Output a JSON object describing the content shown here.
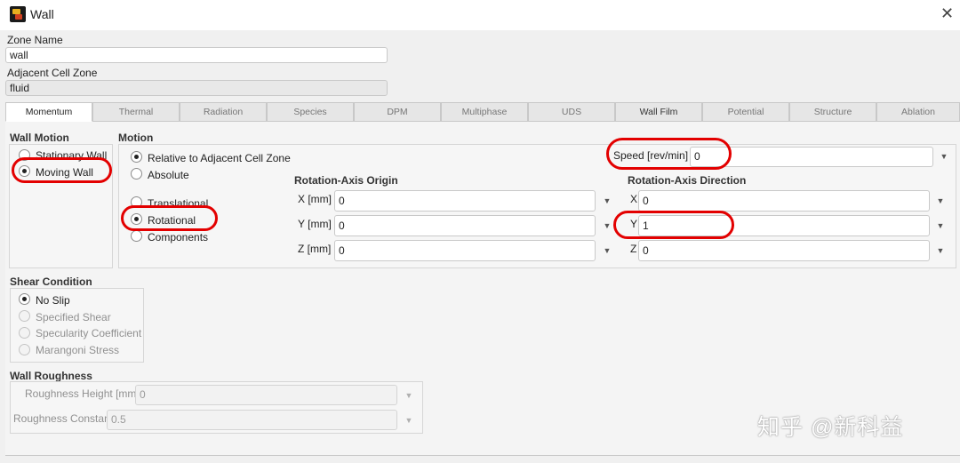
{
  "window": {
    "title": "Wall"
  },
  "zone": {
    "name_label": "Zone Name",
    "name_value": "wall",
    "adjacent_label": "Adjacent Cell Zone",
    "adjacent_value": "fluid"
  },
  "tabs": [
    {
      "label": "Momentum"
    },
    {
      "label": "Thermal"
    },
    {
      "label": "Radiation"
    },
    {
      "label": "Species"
    },
    {
      "label": "DPM"
    },
    {
      "label": "Multiphase"
    },
    {
      "label": "UDS"
    },
    {
      "label": "Wall Film"
    },
    {
      "label": "Potential"
    },
    {
      "label": "Structure"
    },
    {
      "label": "Ablation"
    }
  ],
  "wall_motion": {
    "title": "Wall Motion",
    "stationary": "Stationary Wall",
    "moving": "Moving Wall"
  },
  "motion": {
    "title": "Motion",
    "relative": "Relative to Adjacent Cell Zone",
    "absolute": "Absolute",
    "translational": "Translational",
    "rotational": "Rotational",
    "components": "Components",
    "speed_label": "Speed [rev/min]",
    "speed_value": "0"
  },
  "origin": {
    "title": "Rotation-Axis Origin",
    "x_label": "X [mm]",
    "x_value": "0",
    "y_label": "Y [mm]",
    "y_value": "0",
    "z_label": "Z [mm]",
    "z_value": "0"
  },
  "direction": {
    "title": "Rotation-Axis Direction",
    "x_label": "X",
    "x_value": "0",
    "y_label": "Y",
    "y_value": "1",
    "z_label": "Z",
    "z_value": "0"
  },
  "shear": {
    "title": "Shear Condition",
    "no_slip": "No Slip",
    "specified_shear": "Specified Shear",
    "specularity": "Specularity Coefficient",
    "marangoni": "Marangoni Stress"
  },
  "roughness": {
    "title": "Wall Roughness",
    "height_label": "Roughness Height [mm]",
    "height_value": "0",
    "constant_label": "Roughness Constant",
    "constant_value": "0.5"
  },
  "watermark": "知乎 @新科益",
  "icons": {
    "app": "fluent-app-icon",
    "close": "close-icon",
    "dropdown": "chevron-down-icon"
  },
  "colors": {
    "annotation_ring": "#e30000"
  }
}
